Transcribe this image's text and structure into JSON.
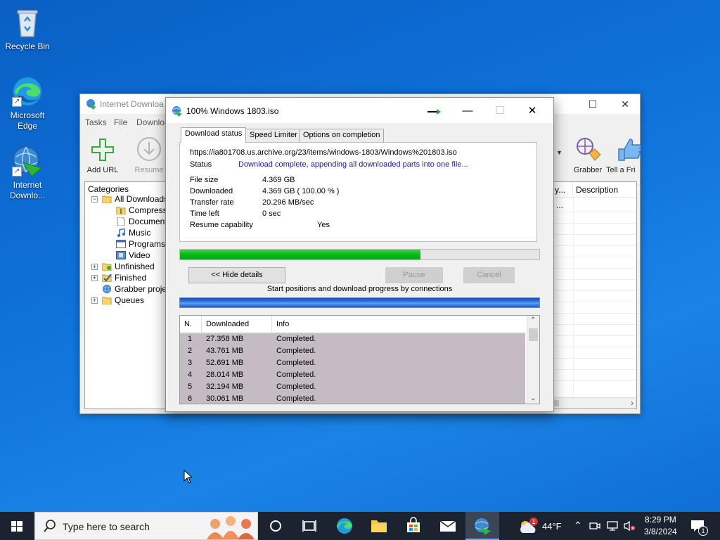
{
  "desktop": {
    "icons": [
      {
        "label": "Recycle Bin"
      },
      {
        "label": "Microsoft Edge"
      },
      {
        "label": "Internet Downlo..."
      }
    ]
  },
  "main_window": {
    "title": "Internet Downloa",
    "menu": [
      "Tasks",
      "File",
      "Downloa"
    ],
    "toolbar": {
      "add_url": "Add URL",
      "resume": "Resume",
      "grabber": "Grabber",
      "tell_friend": "Tell a Fri"
    },
    "categories": {
      "header": "Categories",
      "items": [
        {
          "label": "All Downloads"
        },
        {
          "label": "Compresse"
        },
        {
          "label": "Documents"
        },
        {
          "label": "Music"
        },
        {
          "label": "Programs"
        },
        {
          "label": "Video"
        },
        {
          "label": "Unfinished"
        },
        {
          "label": "Finished"
        },
        {
          "label": "Grabber projec"
        },
        {
          "label": "Queues"
        }
      ]
    },
    "list": {
      "col_partial": "y...",
      "col_description": "Description",
      "row_partial": "..."
    }
  },
  "dialog": {
    "title": "100% Windows 1803.iso",
    "tabs": [
      "Download status",
      "Speed Limiter",
      "Options on completion"
    ],
    "url": "https://ia801708.us.archive.org/23/items/windows-1803/Windows%201803.iso",
    "status_label": "Status",
    "status_value": "Download complete, appending all downloaded parts into one file...",
    "file_size_label": "File size",
    "file_size_value": "4.369  GB",
    "downloaded_label": "Downloaded",
    "downloaded_value": "4.369  GB  ( 100.00 % )",
    "transfer_rate_label": "Transfer rate",
    "transfer_rate_value": "20.296  MB/sec",
    "time_left_label": "Time left",
    "time_left_value": "0 sec",
    "resume_label": "Resume capability",
    "resume_value": "Yes",
    "progress_fraction": 0.67,
    "buttons": {
      "hide_details": "<< Hide details",
      "pause": "Pause",
      "cancel": "Cancel"
    },
    "connections_label": "Start positions and download progress by connections",
    "connections": {
      "headers": [
        "N.",
        "Downloaded",
        "Info"
      ],
      "rows": [
        {
          "n": "1",
          "downloaded": "27.358  MB",
          "info": "Completed."
        },
        {
          "n": "2",
          "downloaded": "43.761  MB",
          "info": "Completed."
        },
        {
          "n": "3",
          "downloaded": "52.691  MB",
          "info": "Completed."
        },
        {
          "n": "4",
          "downloaded": "28.014  MB",
          "info": "Completed."
        },
        {
          "n": "5",
          "downloaded": "32.194  MB",
          "info": "Completed."
        },
        {
          "n": "6",
          "downloaded": "30.061  MB",
          "info": "Completed."
        }
      ]
    }
  },
  "taskbar": {
    "search_placeholder": "Type here to search",
    "weather_temp": "44°F",
    "weather_badge": "1",
    "time": "8:29 PM",
    "date": "3/8/2024",
    "notification_count": "1"
  }
}
